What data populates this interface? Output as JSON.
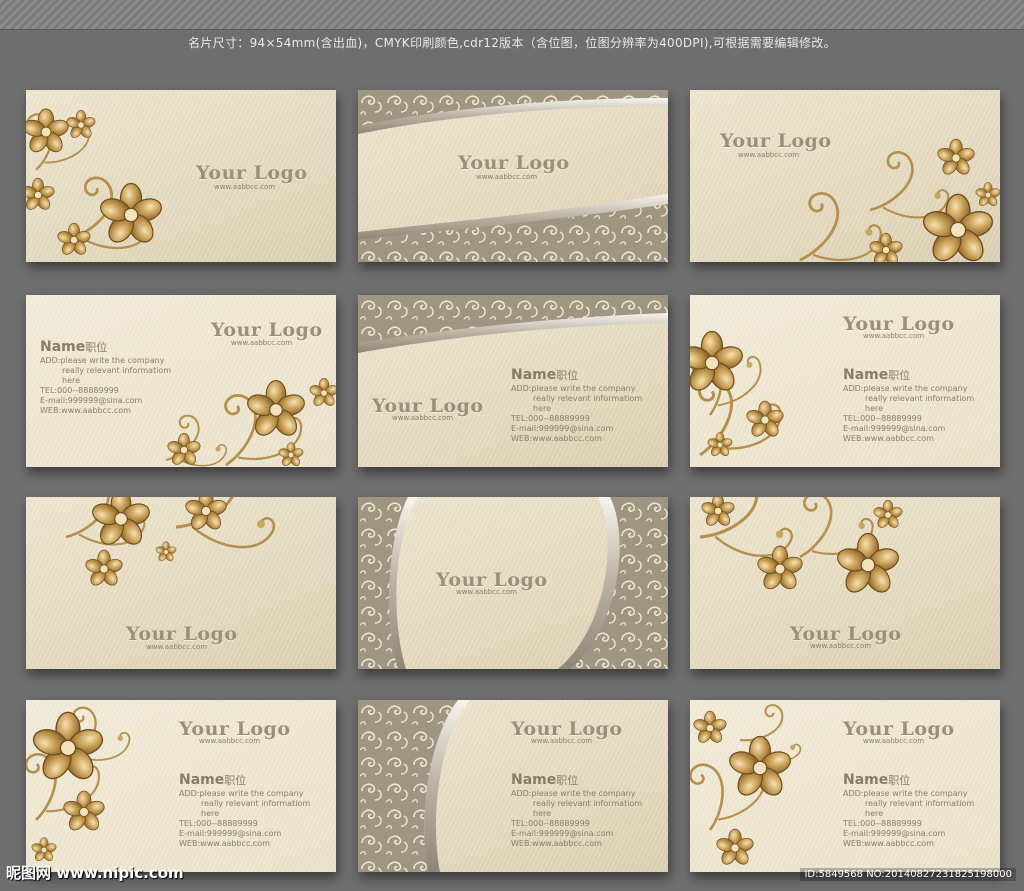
{
  "header": "名片尺寸：94×54mm(含出血)，CMYK印刷颜色,cdr12版本（含位图，位图分辨率为400DPI),可根据需要编辑修改。",
  "logo_text": "Your Logo",
  "web_text": "www.aabbcc.com",
  "contact": {
    "name": "Name",
    "position": "职位",
    "add1": "ADD:please write the company",
    "add2": "really relevant informatiom",
    "add3": "here",
    "tel": "TEL:000--88889999",
    "email": "E-mail:999999@sina.com",
    "web": "WEB:www.aabbcc.com"
  },
  "footer": {
    "site": "昵图网 www.nipic.com",
    "id": "ID:5849568 NO:20140827231825198000"
  },
  "colors": {
    "background": "#6e6e6e",
    "card": "#e9dfc5",
    "gold": "#b08a45",
    "silver": "#a89f8c"
  },
  "cards": [
    {
      "style": "floral-left",
      "has_contact": false
    },
    {
      "style": "swirl-bands",
      "has_contact": false
    },
    {
      "style": "floral-right",
      "has_contact": false
    },
    {
      "style": "floral-bottom-right",
      "has_contact": true
    },
    {
      "style": "swirl-top",
      "has_contact": true
    },
    {
      "style": "floral-left-contact",
      "has_contact": true
    },
    {
      "style": "floral-top",
      "has_contact": false
    },
    {
      "style": "swirl-sides",
      "has_contact": false
    },
    {
      "style": "floral-top-right",
      "has_contact": false
    },
    {
      "style": "floral-left",
      "has_contact": true
    },
    {
      "style": "swirl-left",
      "has_contact": true
    },
    {
      "style": "floral-left",
      "has_contact": true
    }
  ]
}
